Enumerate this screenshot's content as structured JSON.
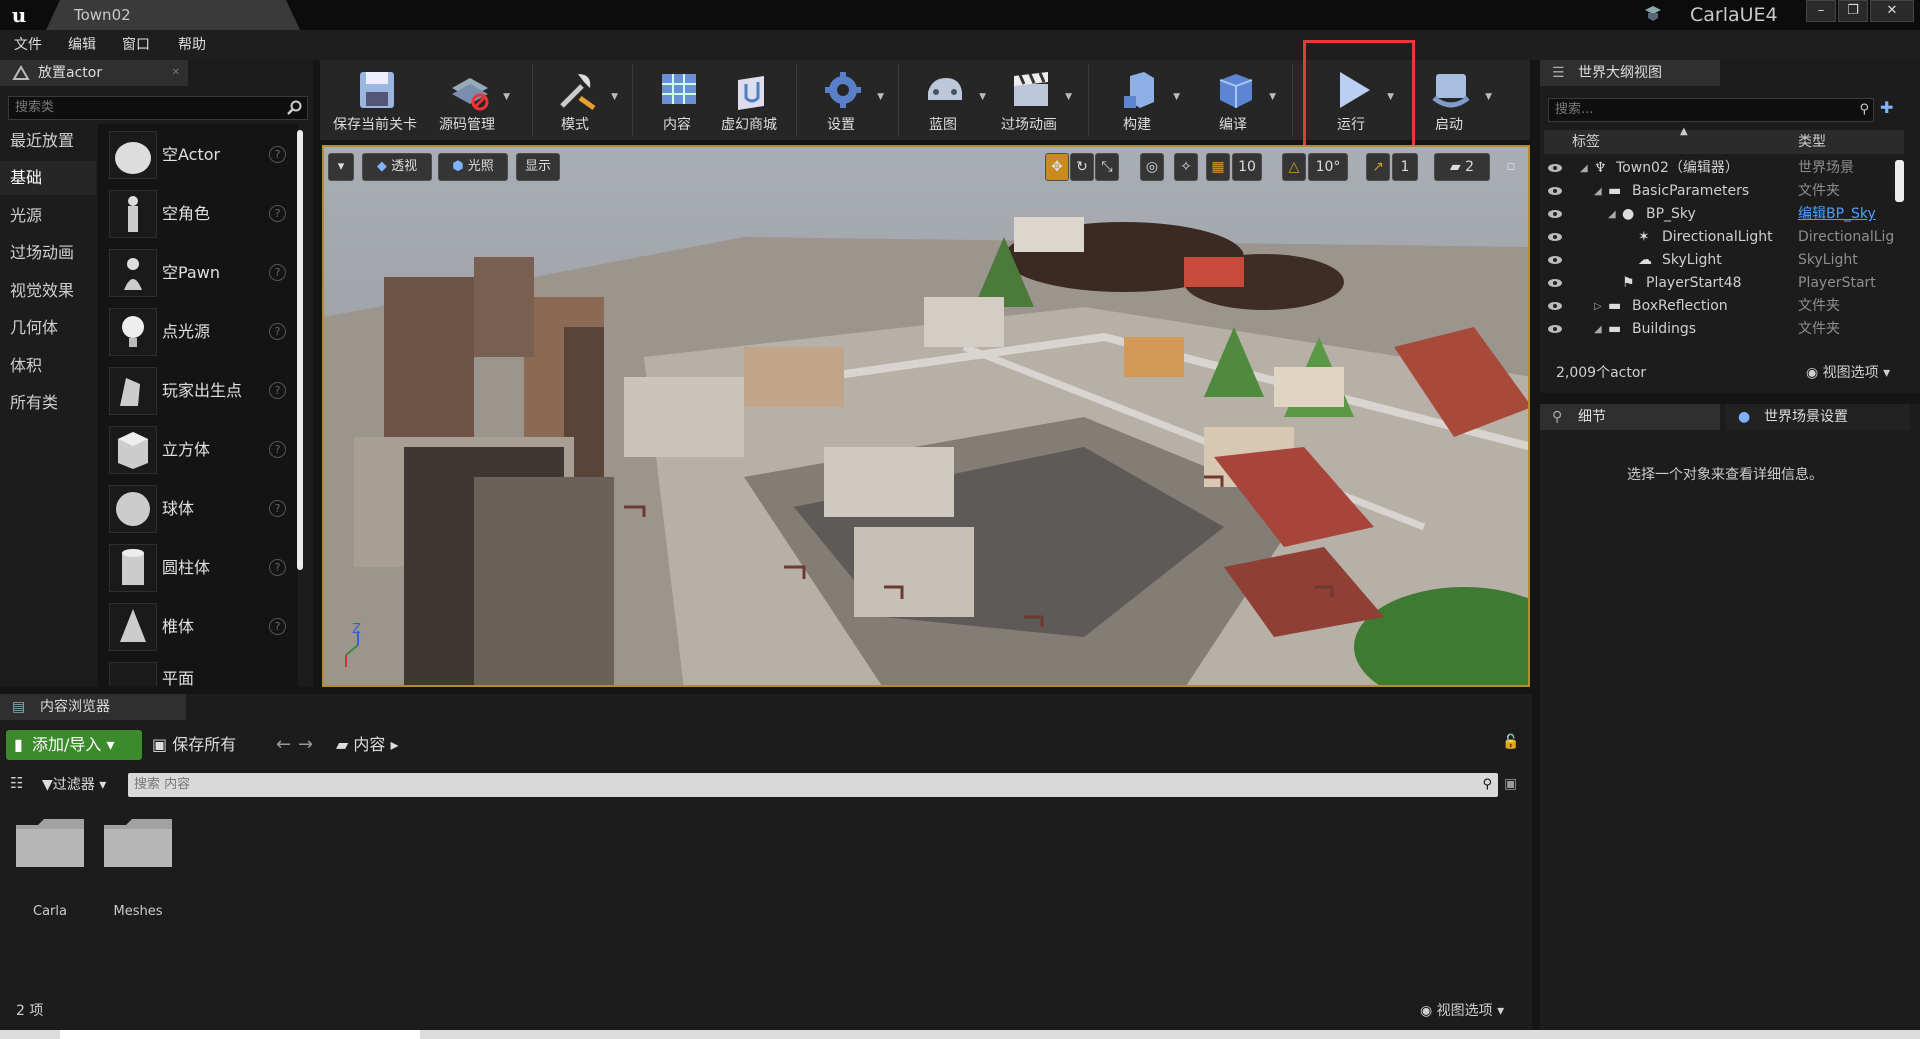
{
  "window": {
    "tab_title": "Town02",
    "project_name": "CarlaUE4",
    "buttons": [
      "–",
      "❐",
      "✕"
    ]
  },
  "menu": [
    "文件",
    "编辑",
    "窗口",
    "帮助"
  ],
  "place_actors": {
    "tab_label": "放置actor",
    "search_placeholder": "搜索类",
    "categories": [
      "最近放置",
      "基础",
      "光源",
      "过场动画",
      "视觉效果",
      "几何体",
      "体积",
      "所有类"
    ],
    "active_category": "基础",
    "items": [
      "空Actor",
      "空角色",
      "空Pawn",
      "点光源",
      "玩家出生点",
      "立方体",
      "球体",
      "圆柱体",
      "椎体",
      "平面"
    ]
  },
  "toolbar": {
    "buttons": [
      {
        "label": "保存当前关卡",
        "icon": "save-icon"
      },
      {
        "label": "源码管理",
        "icon": "source-control-icon"
      },
      {
        "label": "模式",
        "icon": "modes-icon"
      },
      {
        "label": "内容",
        "icon": "content-icon"
      },
      {
        "label": "虚幻商城",
        "icon": "marketplace-icon"
      },
      {
        "label": "设置",
        "icon": "settings-icon"
      },
      {
        "label": "蓝图",
        "icon": "blueprint-icon"
      },
      {
        "label": "过场动画",
        "icon": "cinematics-icon"
      },
      {
        "label": "构建",
        "icon": "build-icon"
      },
      {
        "label": "编译",
        "icon": "compile-icon"
      },
      {
        "label": "运行",
        "icon": "play-icon"
      },
      {
        "label": "启动",
        "icon": "launch-icon"
      }
    ],
    "highlight_color": "#e23a3a"
  },
  "viewport": {
    "perspective_label": "透视",
    "lit_label": "光照",
    "show_label": "显示",
    "grid_snap": "10",
    "rotation_snap": "10°",
    "scale_snap": "1",
    "camera_speed": "2",
    "axis_labels": {
      "z": "Z"
    }
  },
  "outliner": {
    "tab_label": "世界大纲视图",
    "search_placeholder": "搜索...",
    "col_label": "标签",
    "col_type": "类型",
    "rows": [
      {
        "label": "Town02（编辑器）",
        "type": "世界场景"
      },
      {
        "label": "BasicParameters",
        "type": "文件夹"
      },
      {
        "label": "BP_Sky",
        "type": "编辑BP_Sky"
      },
      {
        "label": "DirectionalLight",
        "type": "DirectionalLig"
      },
      {
        "label": "SkyLight",
        "type": "SkyLight"
      },
      {
        "label": "PlayerStart48",
        "type": "PlayerStart"
      },
      {
        "label": "BoxReflection",
        "type": "文件夹"
      },
      {
        "label": "Buildings",
        "type": "文件夹"
      }
    ],
    "actor_count": "2,009个actor",
    "view_options": "视图选项"
  },
  "details": {
    "tab_details": "细节",
    "tab_world_settings": "世界场景设置",
    "empty_message": "选择一个对象来查看详细信息。"
  },
  "content_browser": {
    "tab_label": "内容浏览器",
    "add_import": "添加/导入",
    "save_all": "保存所有",
    "path_root": "内容",
    "filters": "过滤器",
    "search_placeholder": "搜索 内容",
    "folders": [
      "Carla",
      "Meshes"
    ],
    "item_count": "2 项",
    "view_options": "视图选项"
  },
  "colors": {
    "accent_green": "#3b8a2b",
    "viewport_border": "#b18d2c",
    "link_blue": "#4da0ff"
  }
}
